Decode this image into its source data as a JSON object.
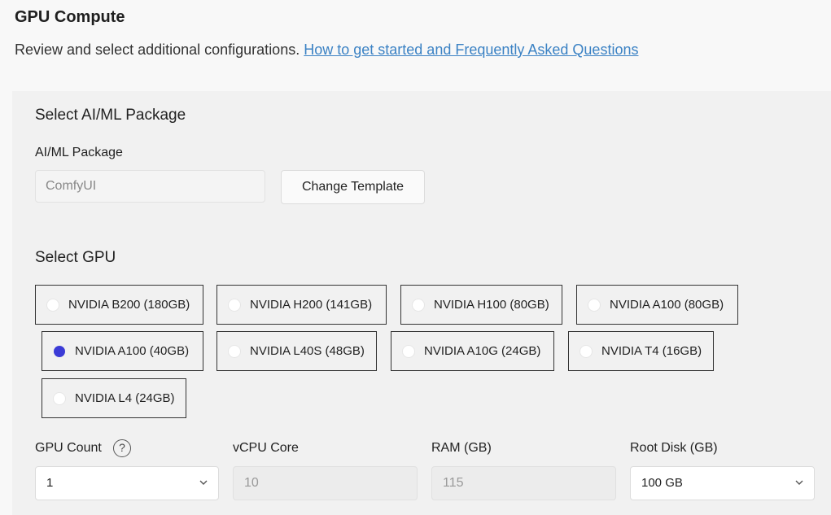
{
  "header": {
    "title": "GPU Compute",
    "subtitle": "Review and select additional configurations.",
    "help_link": "How to get started and Frequently Asked Questions"
  },
  "package_section": {
    "title": "Select AI/ML Package",
    "field_label": "AI/ML Package",
    "value": "ComfyUI",
    "change_button": "Change Template"
  },
  "gpu_section": {
    "title": "Select GPU",
    "selected": "NVIDIA A100 (40GB)",
    "options": [
      "NVIDIA B200 (180GB)",
      "NVIDIA H200 (141GB)",
      "NVIDIA H100 (80GB)",
      "NVIDIA A100 (80GB)",
      "NVIDIA A100 (40GB)",
      "NVIDIA L40S (48GB)",
      "NVIDIA A10G (24GB)",
      "NVIDIA T4 (16GB)",
      "NVIDIA L4 (24GB)"
    ]
  },
  "config": {
    "gpu_count": {
      "label": "GPU Count",
      "value": "1",
      "help": "?"
    },
    "vcpu": {
      "label": "vCPU Core",
      "value": "10"
    },
    "ram": {
      "label": "RAM (GB)",
      "value": "115"
    },
    "root_disk": {
      "label": "Root Disk (GB)",
      "value": "100 GB"
    }
  },
  "colors": {
    "accent": "#3b3bd6",
    "link": "#3b82c4"
  }
}
